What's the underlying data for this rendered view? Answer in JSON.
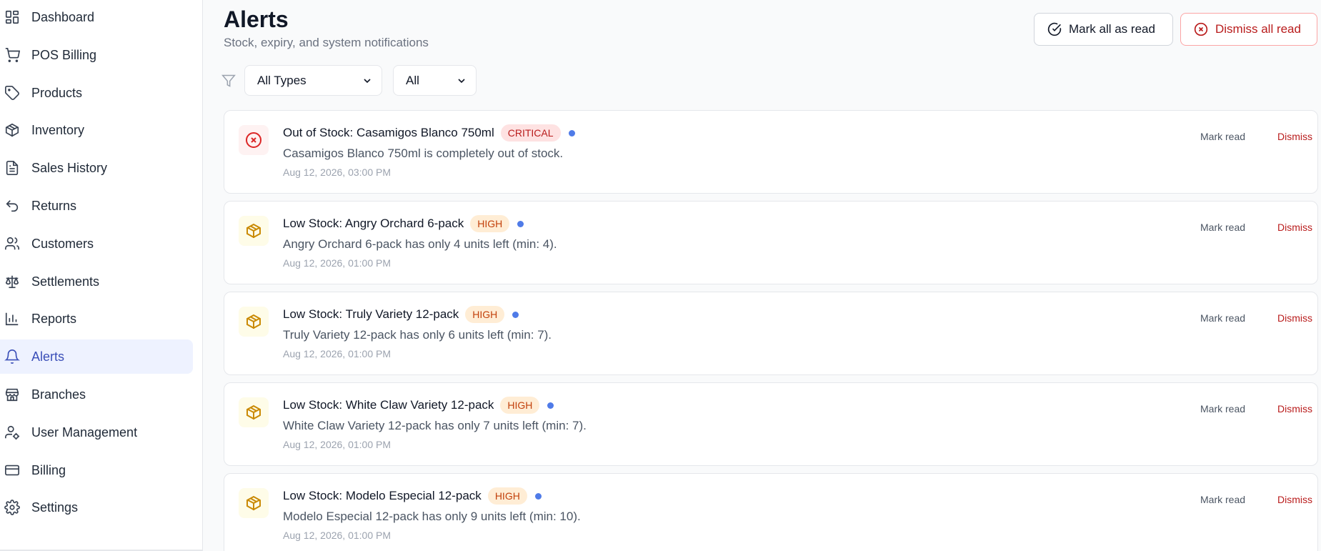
{
  "sidebar": {
    "items": [
      {
        "label": "Dashboard",
        "icon": "dashboard-icon"
      },
      {
        "label": "POS Billing",
        "icon": "cart-icon"
      },
      {
        "label": "Products",
        "icon": "tag-icon"
      },
      {
        "label": "Inventory",
        "icon": "package-icon"
      },
      {
        "label": "Sales History",
        "icon": "document-icon"
      },
      {
        "label": "Returns",
        "icon": "return-arrow-icon"
      },
      {
        "label": "Customers",
        "icon": "users-icon"
      },
      {
        "label": "Settlements",
        "icon": "scale-icon"
      },
      {
        "label": "Reports",
        "icon": "bar-chart-icon"
      },
      {
        "label": "Alerts",
        "icon": "bell-icon",
        "active": true
      },
      {
        "label": "Branches",
        "icon": "store-icon"
      },
      {
        "label": "User Management",
        "icon": "user-cog-icon"
      },
      {
        "label": "Billing",
        "icon": "credit-card-icon"
      },
      {
        "label": "Settings",
        "icon": "gear-icon"
      }
    ]
  },
  "header": {
    "title": "Alerts",
    "subtitle": "Stock, expiry, and system notifications",
    "mark_all_label": "Mark all as read",
    "dismiss_all_label": "Dismiss all read"
  },
  "filters": {
    "type_value": "All Types",
    "status_value": "All"
  },
  "alerts": [
    {
      "title": "Out of Stock: Casamigos Blanco 750ml",
      "severity": "CRITICAL",
      "message": "Casamigos Blanco 750ml is completely out of stock.",
      "time": "Aug 12, 2026, 03:00 PM",
      "mark_read": "Mark read",
      "dismiss": "Dismiss"
    },
    {
      "title": "Low Stock: Angry Orchard 6-pack",
      "severity": "HIGH",
      "message": "Angry Orchard 6-pack has only 4 units left (min: 4).",
      "time": "Aug 12, 2026, 01:00 PM",
      "mark_read": "Mark read",
      "dismiss": "Dismiss"
    },
    {
      "title": "Low Stock: Truly Variety 12-pack",
      "severity": "HIGH",
      "message": "Truly Variety 12-pack has only 6 units left (min: 7).",
      "time": "Aug 12, 2026, 01:00 PM",
      "mark_read": "Mark read",
      "dismiss": "Dismiss"
    },
    {
      "title": "Low Stock: White Claw Variety 12-pack",
      "severity": "HIGH",
      "message": "White Claw Variety 12-pack has only 7 units left (min: 7).",
      "time": "Aug 12, 2026, 01:00 PM",
      "mark_read": "Mark read",
      "dismiss": "Dismiss"
    },
    {
      "title": "Low Stock: Modelo Especial 12-pack",
      "severity": "HIGH",
      "message": "Modelo Especial 12-pack has only 9 units left (min: 10).",
      "time": "Aug 12, 2026, 01:00 PM",
      "mark_read": "Mark read",
      "dismiss": "Dismiss"
    }
  ],
  "colors": {
    "accent": "#3b4fb8",
    "critical": "#b91c1c",
    "high": "#c2410c",
    "unread_dot": "#4f7be8"
  }
}
